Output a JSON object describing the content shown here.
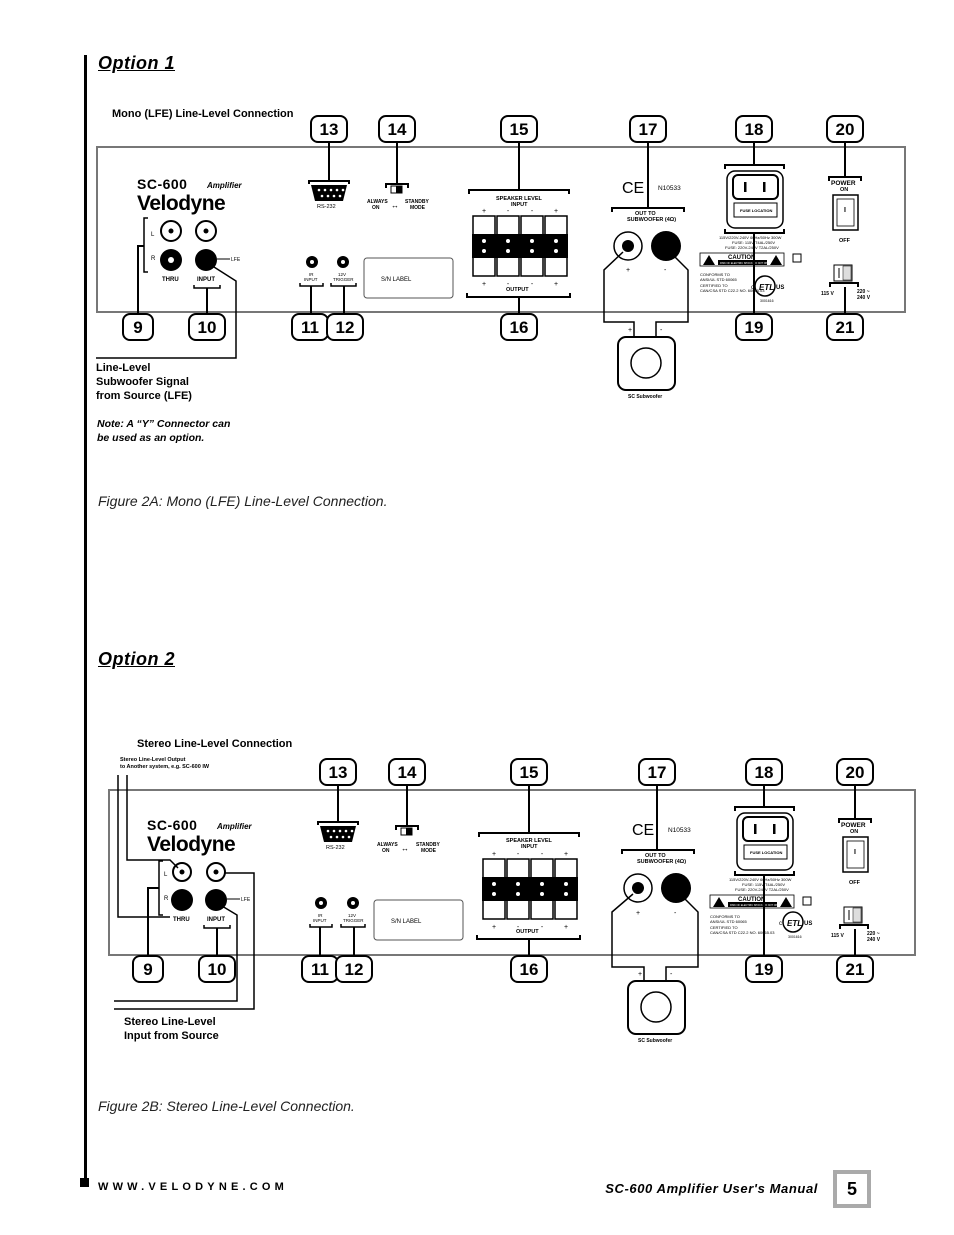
{
  "page": {
    "option1_title": "Option 1",
    "option2_title": "Option 2",
    "figure_2a_caption": "Figure 2A: Mono (LFE) Line-Level Connection.",
    "figure_2b_caption": "Figure 2B: Stereo Line-Level Connection.",
    "footer_url": "WWW.VELODYNE.COM",
    "footer_manual": "SC-600 Amplifier User's Manual",
    "page_number": "5"
  },
  "panel": {
    "model": "SC-600",
    "model_suffix": "Amplifier",
    "brand": "Velodyne",
    "label_l": "L",
    "label_r": "R",
    "thru": "THRU",
    "input": "INPUT",
    "lfe": "LFE",
    "rs232": "RS-232",
    "always_on_1": "ALWAYS",
    "always_on_2": "ON",
    "standby_1": "STANDBY",
    "standby_2": "MODE",
    "arrows": "↔",
    "ir_1": "IR",
    "ir_2": "INPUT",
    "trig_1": "12V",
    "trig_2": "TRIGGER",
    "sn_label": "S/N LABEL",
    "spk_in_1": "SPEAKER LEVEL",
    "spk_in_2": "INPUT",
    "spk_out": "OUTPUT",
    "spk_polarity": [
      "+",
      "-",
      "-",
      "+"
    ],
    "ce_mark": "CE",
    "ce_code": "N10533",
    "out_sub_1": "OUT TO",
    "out_sub_2": "SUBWOOFER (4Ω)",
    "plus": "+",
    "minus": "-",
    "fuse_location": "FUSE LOCATION",
    "rating_1": "115V/220V-240V 60Hz/50Hz 300W",
    "rating_2": "FUSE: 115V  T4AL/250V",
    "rating_3": "FUSE: 220V-240V  T2AL/250V",
    "caution": "CAUTION",
    "caution_sub": "RISK OF ELECTRIC SHOCK DO NOT OPEN",
    "conforms_1": "CONFORMS TO",
    "conforms_2": "ANSI/UL STD 60065",
    "conforms_3": "CERTIFIED TO",
    "conforms_4": "CAN/CSA STD C22.2 NO. 60065.03",
    "etl_c": "c",
    "etl_us": "US",
    "etl_code": "3001616",
    "power": "POWER",
    "power_on": "ON",
    "power_off": "OFF",
    "power_i": "I",
    "v115": "115 V",
    "v220_1": "220 ~",
    "v220_2": "240 V",
    "voltage_switch": "115V",
    "sub_label": "SC Subwoofer"
  },
  "callouts": {
    "c9": "9",
    "c10": "10",
    "c11": "11",
    "c12": "12",
    "c13": "13",
    "c14": "14",
    "c15": "15",
    "c16": "16",
    "c17": "17",
    "c18": "18",
    "c19": "19",
    "c20": "20",
    "c21": "21"
  },
  "figure_a": {
    "heading": "Mono (LFE) Line-Level Connection",
    "source_1": "Line-Level",
    "source_2": "Subwoofer Signal",
    "source_3": "from Source (LFE)",
    "note_1": "Note:  A “Y” Connector can",
    "note_2": "be used as an option."
  },
  "figure_b": {
    "heading": "Stereo Line-Level Connection",
    "out_note_1": "Stereo Line-Level Output",
    "out_note_2": "to Another system, e.g. SC-600 IW",
    "source_1": "Stereo Line-Level",
    "source_2": "Input from Source"
  }
}
